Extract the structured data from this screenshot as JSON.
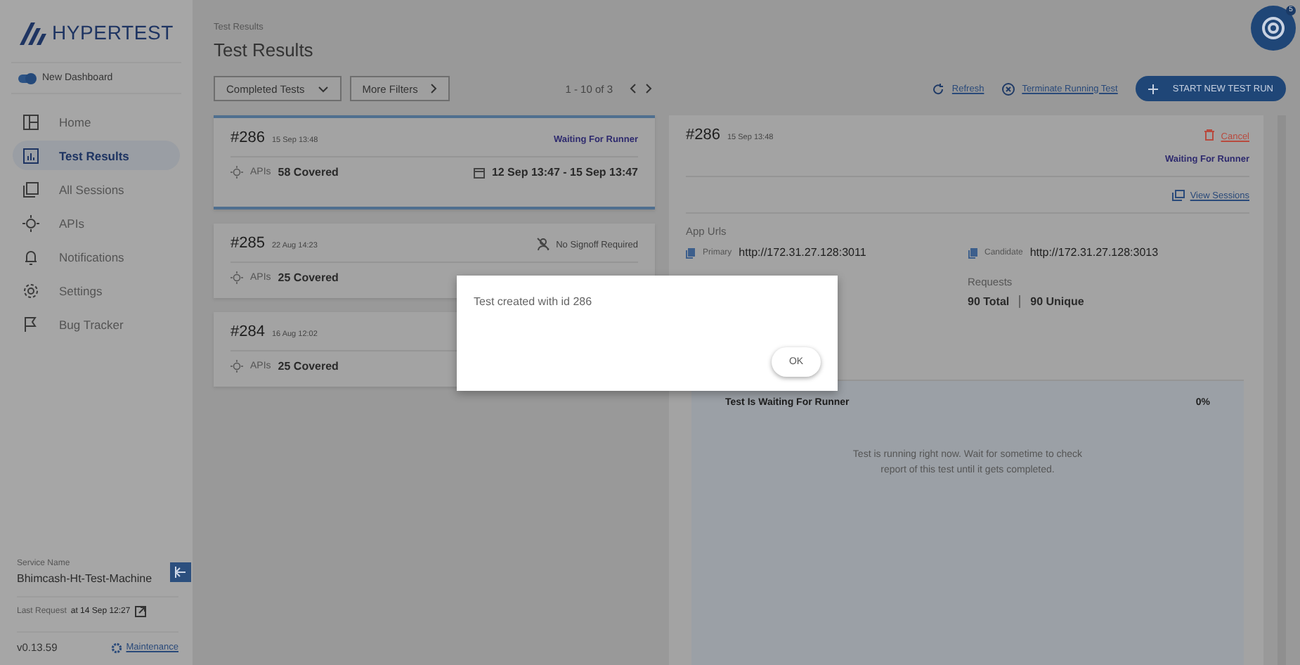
{
  "brand": "HYPERTEST",
  "dashboard_toggle": {
    "label": "New Dashboard",
    "on": true
  },
  "sidebar": {
    "items": [
      {
        "label": "Home",
        "selected": false
      },
      {
        "label": "Test Results",
        "selected": true
      },
      {
        "label": "All Sessions",
        "selected": false
      },
      {
        "label": "APIs",
        "selected": false
      },
      {
        "label": "Notifications",
        "selected": false
      },
      {
        "label": "Settings",
        "selected": false
      },
      {
        "label": "Bug Tracker",
        "selected": false
      }
    ]
  },
  "service": {
    "caption": "Service Name",
    "name": "Bhimcash-Ht-Test-Machine",
    "last_request_label": "Last Request",
    "last_request": "at 14 Sep 12:27",
    "version": "v0.13.59",
    "maintenance": "Maintenance"
  },
  "breadcrumb": "Test Results",
  "title": "Test Results",
  "filters": [
    {
      "label": "Completed Tests",
      "kind": "dropdown"
    },
    {
      "label": "More Filters",
      "kind": "next"
    }
  ],
  "pagination": "1 - 10 of 3",
  "actions": {
    "refresh": "Refresh",
    "terminate": "Terminate Running Test",
    "start": "START NEW TEST RUN"
  },
  "notification_badge": "5",
  "tests": [
    {
      "id": "#286",
      "date": "15 Sep 13:48",
      "kind": "waiting",
      "status": "Waiting For Runner",
      "apis_label": "APIs",
      "apis": "58 Covered",
      "range": "12 Sep 13:47 - 15 Sep 13:47",
      "selected": true
    },
    {
      "id": "#285",
      "date": "22 Aug 14:23",
      "kind": "signoff",
      "status": "No Signoff Required",
      "apis_label": "APIs",
      "apis": "25 Covered",
      "selected": false
    },
    {
      "id": "#284",
      "date": "16 Aug 12:02",
      "apis_label": "APIs",
      "apis": "25 Covered",
      "selected": false
    }
  ],
  "detail": {
    "id": "#286",
    "date": "15 Sep 13:48",
    "cancel": "Cancel",
    "status": "Waiting For Runner",
    "view_sessions": "View Sessions",
    "app_urls_label": "App Urls",
    "urls": [
      {
        "label": "Primary",
        "value": "http://172.31.27.128:3011"
      },
      {
        "label": "Candidate",
        "value": "http://172.31.27.128:3013"
      }
    ],
    "requests_label": "Requests",
    "requests_total": "90 Total",
    "requests_unique": "90 Unique",
    "progress_title": "Test Is Waiting For Runner",
    "progress_percent": "0%",
    "message": "Test is running right now. Wait for sometime to check report of this test until it gets completed."
  },
  "dialog": {
    "message": "Test created with id 286",
    "button": "OK"
  }
}
